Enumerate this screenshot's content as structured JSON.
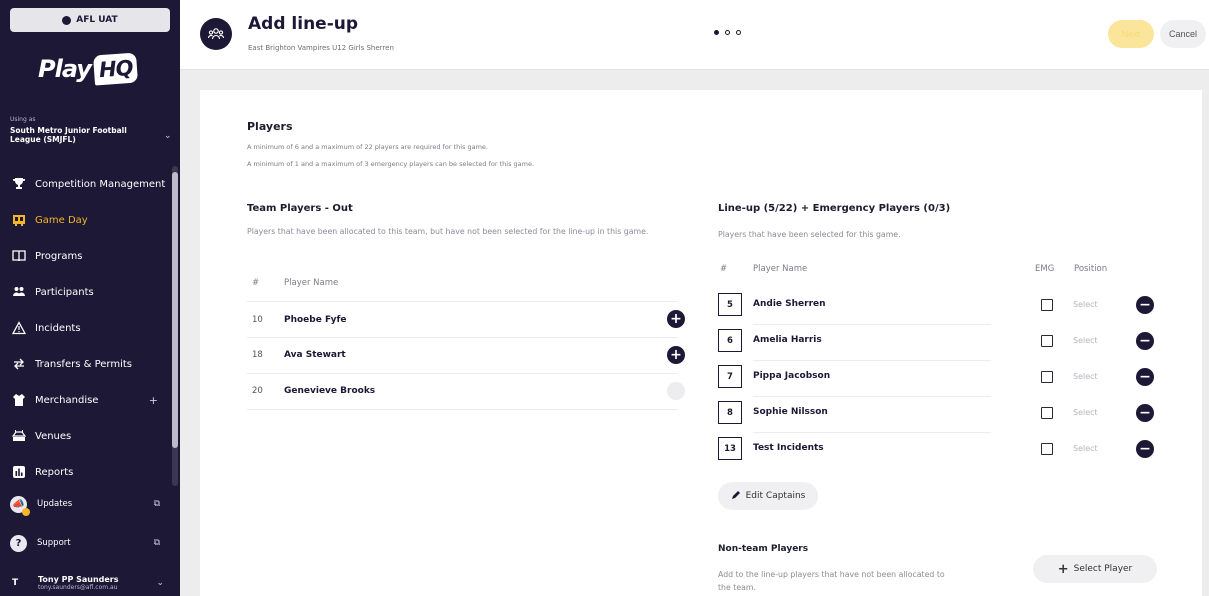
{
  "sidebar": {
    "env_label": "AFL UAT",
    "logo": "PlayHQ",
    "logo_parts": [
      "Play",
      "HQ"
    ],
    "using_as_label": "Using as",
    "org_name": "South Metro Junior Football League (SMJFL)",
    "nav": [
      {
        "label": "Competition Management",
        "icon": "trophy-icon"
      },
      {
        "label": "Game Day",
        "icon": "scoreboard-icon",
        "active": true
      },
      {
        "label": "Programs",
        "icon": "book-icon"
      },
      {
        "label": "Participants",
        "icon": "people-icon"
      },
      {
        "label": "Incidents",
        "icon": "warning-icon"
      },
      {
        "label": "Transfers & Permits",
        "icon": "transfer-icon"
      },
      {
        "label": "Merchandise",
        "icon": "tshirt-icon",
        "expand": "+"
      },
      {
        "label": "Venues",
        "icon": "stadium-icon"
      },
      {
        "label": "Reports",
        "icon": "chart-icon"
      }
    ],
    "updates_label": "Updates",
    "support_label": "Support",
    "user_initial": "T",
    "user_name": "Tony PP Saunders",
    "user_email": "tony.saunders@afl.com.au"
  },
  "header": {
    "title": "Add line-up",
    "subtitle": "East Brighton Vampires U12 Girls Sherren",
    "step_count": 3,
    "current_step": 1,
    "next_label": "Next",
    "cancel_label": "Cancel"
  },
  "players": {
    "title": "Players",
    "note1": "A minimum of 6 and a maximum of 22 players are required for this game.",
    "note2": "A minimum of 1 and a maximum of 3 emergency players can be selected for this game."
  },
  "team_out": {
    "title": "Team Players - Out",
    "description": "Players that have been allocated to this team, but have not been selected for the line-up in this game.",
    "col_num": "#",
    "col_name": "Player Name",
    "rows": [
      {
        "num": "10",
        "name": "Phoebe Fyfe",
        "add_enabled": true
      },
      {
        "num": "18",
        "name": "Ava Stewart",
        "add_enabled": true
      },
      {
        "num": "20",
        "name": "Genevieve Brooks",
        "add_enabled": false
      }
    ]
  },
  "lineup": {
    "title": "Line-up (5/22) + Emergency Players (0/3)",
    "description": "Players that have been selected for this game.",
    "col_num": "#",
    "col_name": "Player Name",
    "col_emg": "EMG",
    "col_position": "Position",
    "rows": [
      {
        "num": "5",
        "name": "Andie Sherren",
        "position": "Select",
        "emergency": false
      },
      {
        "num": "6",
        "name": "Amelia Harris",
        "position": "Select",
        "emergency": false
      },
      {
        "num": "7",
        "name": "Pippa Jacobson",
        "position": "Select",
        "emergency": false
      },
      {
        "num": "8",
        "name": "Sophie Nilsson",
        "position": "Select",
        "emergency": false
      },
      {
        "num": "13",
        "name": "Test Incidents",
        "position": "Select",
        "emergency": false
      }
    ],
    "edit_captains_label": "Edit Captains"
  },
  "non_team": {
    "title": "Non-team Players",
    "description": "Add to the line-up players that have not been allocated to the team.",
    "select_player_label": "Select Player"
  }
}
